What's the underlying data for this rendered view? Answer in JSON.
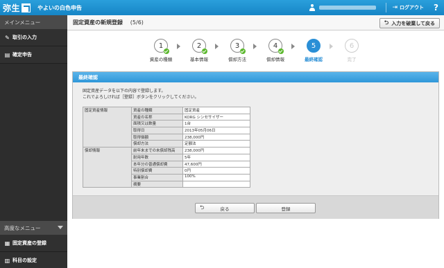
{
  "app": {
    "logo": "弥生",
    "title": "やよいの白色申告"
  },
  "topbar": {
    "logout_label": "ログアウト",
    "help_glyph": "?"
  },
  "sidebar": {
    "header": "メインメニュー",
    "items": [
      {
        "icon": "pencil-icon",
        "label": "取引の入力"
      },
      {
        "icon": "document-icon",
        "label": "確定申告"
      }
    ],
    "advanced_header": "高度なメニュー",
    "advanced_items": [
      {
        "icon": "table-icon",
        "label": "固定資産の登録"
      },
      {
        "icon": "book-icon",
        "label": "科目の設定"
      }
    ]
  },
  "main": {
    "title": "固定資産の新規登録",
    "counter": "(5/6)",
    "discard_label": "入力を破棄して戻る"
  },
  "steps": [
    {
      "num": "1",
      "label": "資産の種類",
      "state": "done"
    },
    {
      "num": "2",
      "label": "基本情報",
      "state": "done"
    },
    {
      "num": "3",
      "label": "償却方法",
      "state": "done"
    },
    {
      "num": "4",
      "label": "償却情報",
      "state": "done"
    },
    {
      "num": "5",
      "label": "最終確認",
      "state": "active"
    },
    {
      "num": "6",
      "label": "完了",
      "state": "pending"
    }
  ],
  "panel": {
    "title": "最終確認",
    "intro_line1": "固定資産データを以下の内容で登録します。",
    "intro_line2": "これでよろしければ［登録］ボタンをクリックしてください。",
    "groups": [
      {
        "name": "固定資産情報",
        "rows": [
          {
            "key": "資産の種類",
            "value": "固定資産"
          },
          {
            "key": "資産の名称",
            "value": "KORG シンセサイザー"
          },
          {
            "key": "面積又は数量",
            "value": "1台"
          },
          {
            "key": "取得日",
            "value": "2013年05月06日"
          },
          {
            "key": "取得価額",
            "value": "238,000円"
          },
          {
            "key": "償却方法",
            "value": "定額法"
          }
        ]
      },
      {
        "name": "償却情報",
        "rows": [
          {
            "key": "前年末までの未償却残高",
            "value": "238,000円"
          },
          {
            "key": "耐用年数",
            "value": "5年"
          },
          {
            "key": "本年分の普通償却費",
            "value": "47,600円"
          },
          {
            "key": "特別償却費",
            "value": "0円"
          },
          {
            "key": "事業割合",
            "value": "100%"
          },
          {
            "key": "摘要",
            "value": ""
          }
        ]
      }
    ],
    "back_label": "戻る",
    "register_label": "登録"
  },
  "colors": {
    "accent": "#2a8fd6",
    "check": "#5cb82e",
    "sidebar": "#2d2d2d"
  }
}
